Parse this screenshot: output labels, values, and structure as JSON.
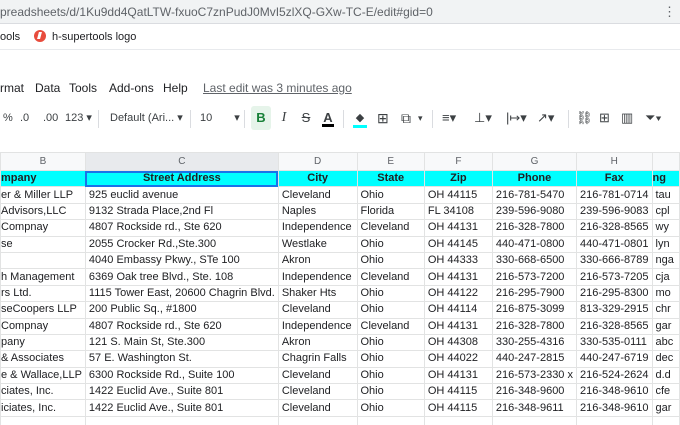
{
  "browser": {
    "url": "preadsheets/d/1Ku9dd4QatLTW-fxuoC7znPudJ0MvI5zlXQ-GXw-TC-E/edit#gid=0",
    "bookmarks": [
      "ools",
      "h-supertools logo"
    ]
  },
  "menu": {
    "items": [
      "rmat",
      "Data",
      "Tools",
      "Add-ons",
      "Help"
    ],
    "last_edit": "Last edit was 3 minutes ago"
  },
  "toolbar": {
    "percent": "%",
    "dec_less": ".0",
    "dec_more": ".00",
    "more_formats": "123",
    "font": "Default (Ari...",
    "font_size": "10",
    "bold": "B",
    "italic": "I",
    "strike": "S",
    "text_color": "A"
  },
  "columns": [
    "B",
    "C",
    "D",
    "E",
    "F",
    "G",
    "H"
  ],
  "headers": [
    "mpany",
    "Street Address",
    "City",
    "State",
    "Zip",
    "Phone",
    "Fax",
    "ng"
  ],
  "rows": [
    [
      "er & Miller LLP",
      "925 euclid avenue",
      "Cleveland",
      "Ohio",
      "OH 44115",
      "216-781-5470",
      "216-781-0714",
      "tau"
    ],
    [
      "Advisors,LLC",
      "9132 Strada Place,2nd Fl",
      "Naples",
      "Florida",
      "FL 34108",
      "239-596-9080",
      "239-596-9083",
      "cpl"
    ],
    [
      "Compnay",
      "4807 Rockside rd., Ste 620",
      "Independence",
      "Cleveland",
      "OH 44131",
      "216-328-7800",
      "216-328-8565",
      "wy"
    ],
    [
      "se",
      "2055 Crocker Rd.,Ste.300",
      "Westlake",
      "Ohio",
      "OH 44145",
      "440-471-0800",
      "440-471-0801",
      "lyn"
    ],
    [
      "",
      "4040 Embassy Pkwy., STe 100",
      "Akron",
      "Ohio",
      "OH 44333",
      "330-668-6500",
      "330-666-8789",
      "nga"
    ],
    [
      "h Management",
      "6369 Oak tree Blvd., Ste. 108",
      "Independence",
      "Cleveland",
      "OH 44131",
      "216-573-7200",
      "216-573-7205",
      "cja"
    ],
    [
      "rs Ltd.",
      "1115 Tower East, 20600 Chagrin Blvd.",
      "Shaker Hts",
      "Ohio",
      "OH 44122",
      "216-295-7900",
      "216-295-8300",
      "mo"
    ],
    [
      "seCoopers LLP",
      "200 Public Sq., #1800",
      "Cleveland",
      "Ohio",
      "OH 44114",
      "216-875-3099",
      "813-329-2915",
      "chr"
    ],
    [
      "Compnay",
      "4807 Rockside rd., Ste 620",
      "Independence",
      "Cleveland",
      "OH 44131",
      "216-328-7800",
      "216-328-8565",
      "gar"
    ],
    [
      "pany",
      "121 S. Main St, Ste.300",
      "Akron",
      "Ohio",
      "OH 44308",
      "330-255-4316",
      "330-535-0111",
      "abc"
    ],
    [
      "& Associates",
      "57 E. Washington St.",
      "Chagrin Falls",
      "Ohio",
      "OH 44022",
      "440-247-2815",
      "440-247-6719",
      "dec"
    ],
    [
      "e & Wallace,LLP",
      "6300 Rockside Rd., Suite 100",
      "Cleveland",
      "Ohio",
      "OH 44131",
      "216-573-2330 x",
      "216-524-2624",
      "d.d"
    ],
    [
      "ciates, Inc.",
      "1422  Euclid Ave., Suite 801",
      "Cleveland",
      "Ohio",
      "OH 44115",
      "216-348-9600",
      "216-348-9610",
      "cfe"
    ],
    [
      "iciates, Inc.",
      "1422  Euclid Ave., Suite 801",
      "Cleveland",
      "Ohio",
      "OH 44115",
      "216-348-9611",
      "216-348-9610",
      "gar"
    ],
    [
      "",
      "",
      "",
      "",
      "",
      "",
      "",
      ""
    ]
  ]
}
